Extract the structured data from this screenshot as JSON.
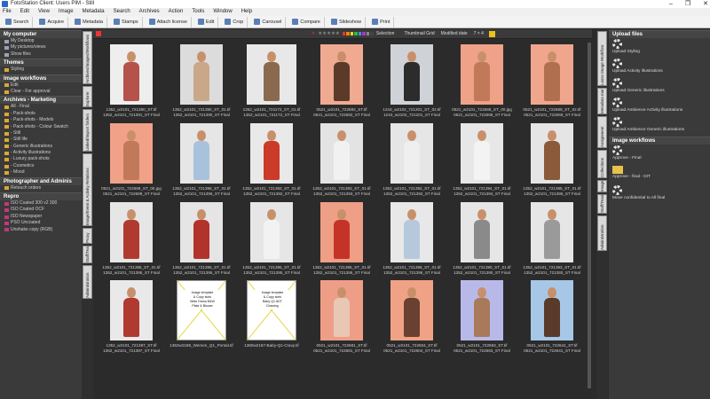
{
  "window": {
    "title": "FotoStation Client: Users PIM  - Still",
    "controls": [
      "–",
      "❐",
      "✕"
    ]
  },
  "menu": [
    "File",
    "Edit",
    "View",
    "Image",
    "Metadata",
    "Search",
    "Archives",
    "Action",
    "Tools",
    "Window",
    "Help"
  ],
  "toolbar": [
    "Search",
    "Acquire",
    "Metadata",
    "Stamps",
    "Attach license",
    "Edit",
    "Crop",
    "Carousel",
    "Compare",
    "Slideshow",
    "Print"
  ],
  "left_panel": {
    "sections": [
      {
        "title": "My computer",
        "items": [
          "My Desktop",
          "My pictures/views",
          "Show files"
        ]
      },
      {
        "title": "Themes",
        "items": [
          "Styling"
        ]
      },
      {
        "title": "Image workflows",
        "items": [
          "Edit",
          "Clear - For approval"
        ]
      },
      {
        "title": "Archives - Marketing",
        "items": [
          "All - Final",
          "- Pack-shots",
          "- Pack-shots - Models",
          "- Pack-shots - Colour Swatch",
          "- Still",
          "- Still life",
          "- Generic illustrations",
          "- Activity illustrations",
          "- Luxury pack-shots",
          "- Cosmetics",
          "- Mood"
        ]
      },
      {
        "title": "Photographer and Adminis",
        "items": [
          "Retouch orders"
        ]
      },
      {
        "title": "Repro",
        "items": [
          "ISO Coated 300 v2 300",
          "ISO Coated OCF",
          "ISO Newspaper",
          "PSO Uncoated",
          "Unshake copy (RGB)"
        ]
      }
    ]
  },
  "left_vtabs": [
    "Archives/Images/Workflows",
    "Explorer",
    "Linked/Import folders",
    "Image/Event & Activity Relations",
    "Proxy",
    "Staff/Team",
    "Administration"
  ],
  "grid_toolbar": {
    "stars": "★★★★★",
    "selection": "Selection",
    "thumbnail": "Thumbnail Grid",
    "sort": "Modified date",
    "size": "7 × 4"
  },
  "grid_rows": [
    [
      [
        "1352_w2101_721390_ST.tif",
        "1352_w2101_721391_ST Final"
      ],
      [
        "1352_w2101_721390_ST_01.tif",
        "1352_w2101_721390_ST Final"
      ],
      [
        "1352_w2101_721172_ST_01.tif",
        "1352_w2101_721172_ST Final"
      ],
      [
        "0521_w2101_722682_ST.tif",
        "0521_w2101_722682_ST Final"
      ],
      [
        "1244_w2102_721201_ST_02.tif",
        "1244_w2102_721201_ST Final"
      ],
      [
        "0521_w2101_722668_ST_00.jpg",
        "0521_w2101_722668_ST Final"
      ],
      [
        "0521_w2101_722669_ST_02.tif",
        "0521_w2101_722669_ST Final"
      ]
    ],
    [
      [
        "0521_w2101_722689_ST_00.jpg",
        "0521_w2101_722689_ST Final"
      ],
      [
        "1352_w2101_721396_ST_01.tif",
        "1352_w2101_721396_ST Final"
      ],
      [
        "1352_w2101_721392_ST_01.tif",
        "1352_w2101_721392_ST Final"
      ],
      [
        "1352_w2101_721393_ST_01.tif",
        "1352_w2101_721393_ST Final"
      ],
      [
        "1352_w2101_721392_ST_01.tif",
        "1352_w2101_721392_ST Final"
      ],
      [
        "1352_w2101_721394_ST_01.tif",
        "1352_w2101_721394_ST Final"
      ],
      [
        "1352_w2101_721395_ST_01.tif",
        "1352_w2101_721395_ST Final"
      ]
    ],
    [
      [
        "1352_w2101_721395_ST_01.tif",
        "1352_w2101_721395_ST Final"
      ],
      [
        "1352_w2101_721395_ST_01.tif",
        "1352_w2101_721395_ST Final"
      ],
      [
        "1352_w2101_721395_ST_01.tif",
        "1352_w2101_721395_ST Final"
      ],
      [
        "1352_w2101_721395_ST_01.tif",
        "1352_w2101_721395_ST Final"
      ],
      [
        "1352_w2101_721396_ST_01.tif",
        "1352_w2101_721396_ST Final"
      ],
      [
        "1352_w2101_721390_ST_01.tif",
        "1352_w2101_721390_ST Final"
      ],
      [
        "1352_w2101_721393_ST_01.tif",
        "1352_w2101_721393_ST Final"
      ]
    ],
    [
      [
        "1352_w2101_721397_ST.tif",
        "1352_w2101_721397_ST Final"
      ],
      [
        "1352w2188_Wemen_Q1_Portait.tif",
        "",
        [
          "Image template",
          "& Copy slots",
          "Wide Dress B&W",
          "Plaid & Blouse"
        ]
      ],
      [
        "1360w2187-Baby-Q1-Cravy.tif",
        "",
        [
          "Image template",
          "& Copy slots",
          "Baby Q1 ADT",
          "Drawing"
        ]
      ],
      [
        "0521_w2101_722681_ST.tif",
        "0521_w2101_722681_ST Final"
      ],
      [
        "0521_w2101_722604_ST.tif",
        "0521_w2101_722604_ST Final"
      ],
      [
        "0521_w2101_722663_ST.tif",
        "0521_w2101_722663_ST Final"
      ],
      [
        "0521_w2101_722641_ST.tif",
        "0521_w2101_722641_ST Final"
      ]
    ]
  ],
  "right_vtabs": [
    "Lasso Image Workflow",
    "Metadata manager",
    "Assignment",
    "Collections",
    "Image",
    "Staff/Team",
    "Administration"
  ],
  "right_panel": {
    "sections": [
      {
        "title": "Upload files",
        "items": [
          "Upload Styling",
          "Upload Activity illustrations",
          "Upload Generic illustrations",
          "Upload Ambience Activity illustrations",
          "Upload Ambience Generic illustrations"
        ]
      },
      {
        "title": "Image workflows",
        "items": [
          "Approve - Final",
          "Approve - final - DIT",
          "Move confidential to All final"
        ]
      }
    ]
  },
  "colors": {
    "bg": "#2b2b2b",
    "panel": "#3a3a3a",
    "gear": "#e6e6e6",
    "folder": "#d9a836"
  }
}
